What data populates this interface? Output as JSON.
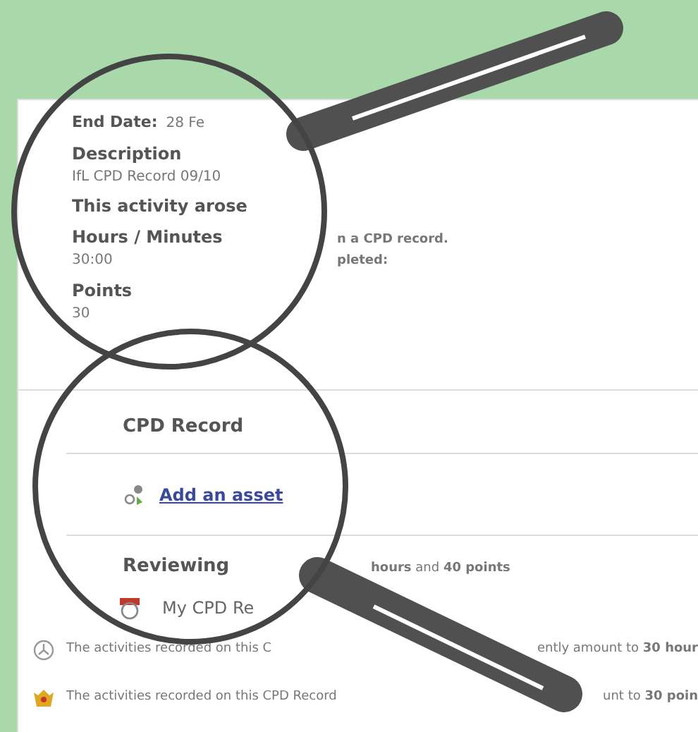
{
  "details": [
    {
      "kind": "inline",
      "label": "End Date:",
      "value": "28 Fe"
    },
    {
      "kind": "stacked",
      "label": "Description",
      "value": "IfL CPD Record 09/10"
    },
    {
      "kind": "stacked",
      "label": "This activity arose"
    },
    {
      "kind": "noted",
      "label": "Hours / Minutes",
      "label_note": "n a CPD record.",
      "value": "30:00",
      "value_note": "pleted:"
    },
    {
      "kind": "stacked",
      "label": "Points",
      "value": "30"
    }
  ],
  "cpd_record": {
    "title": "CPD Record",
    "link": "Add an asset"
  },
  "reviewing": {
    "title": "Reviewing",
    "summary": "**hours** and **40 points**",
    "items": [
      {
        "kind": "calendar",
        "text": "My CPD Re"
      },
      {
        "kind": "clock",
        "text": "The activities recorded on this C",
        "text_end": "ently amount to **30 hour**"
      },
      {
        "kind": "award",
        "text": "The activities recorded on this CPD Record",
        "text_end": "unt to **30 poin**"
      }
    ]
  }
}
